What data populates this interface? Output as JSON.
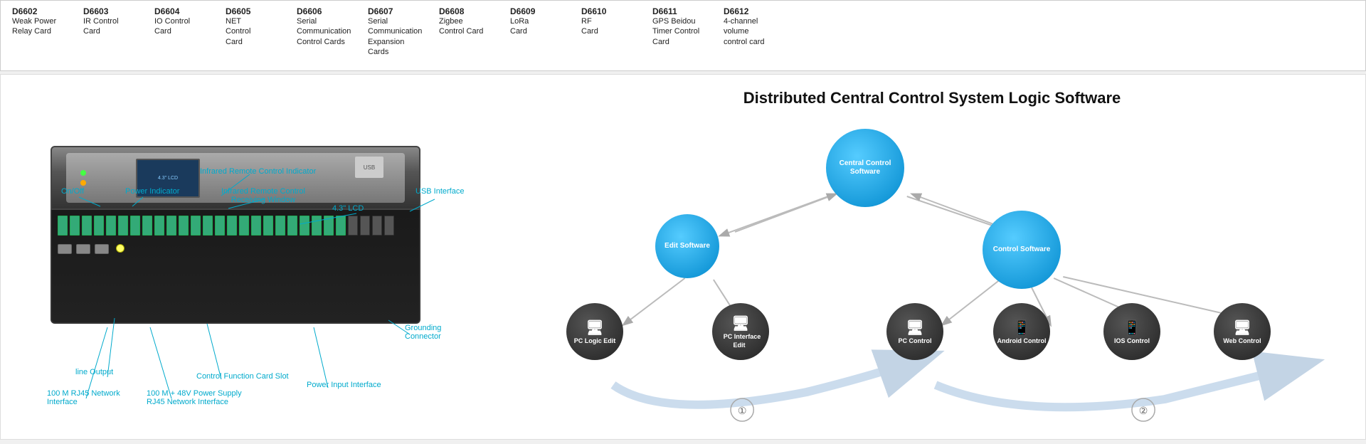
{
  "top_table": {
    "cards": [
      {
        "id": "D6602",
        "name": "Weak Power\nRelay Card"
      },
      {
        "id": "D6603",
        "name": "IR Control\nCard"
      },
      {
        "id": "D6604",
        "name": "IO Control\nCard"
      },
      {
        "id": "D6605",
        "name": "NET\nControl\nCard"
      },
      {
        "id": "D6606",
        "name": "Serial\nCommunication\nControl Cards"
      },
      {
        "id": "D6607",
        "name": "Serial\nCommunication\nExpansion\nCards"
      },
      {
        "id": "D6608",
        "name": "Zigbee\nControl Card"
      },
      {
        "id": "D6609",
        "name": "LoRa\nCard"
      },
      {
        "id": "D6610",
        "name": "RF\nCard"
      },
      {
        "id": "D6611",
        "name": "GPS Beidou\nTimer Control\nCard"
      },
      {
        "id": "D6612",
        "name": "4-channel\nvolume\ncontrol card"
      }
    ]
  },
  "section_labels": {
    "expansion_cards": "Expansion Cards",
    "control_cards": "Control Cards",
    "card": "Card"
  },
  "device_annotations": {
    "on_off": "On/Off",
    "power_indicator": "Power Indicator",
    "infrared_indicator": "Infrared Remote Control Indicator",
    "infrared_window": "Infrared Remote Control\nReceiving Window",
    "lcd": "4.3\" LCD",
    "usb": "USB Interface",
    "grounding": "Grounding\nConnector",
    "line_output": "line Output",
    "network_100m": "100 M RJ45 Network\nInterface",
    "power_supply": "100 M + 48V Power Supply\nRJ45 Network Interface",
    "control_slot": "Control Function Card Slot",
    "power_input": "Power Input Interface"
  },
  "diagram": {
    "title": "Distributed Central Control System Logic Software",
    "nodes": {
      "central": "Central\nControl\nSoftware",
      "edit": "Edit Software",
      "control": "Control\nSoftware",
      "pc_logic": "PC Logic\nEdit",
      "pc_interface": "PC Interface\nEdit",
      "pc_control": "PC Control",
      "android": "Android\nControl",
      "ios": "IOS Control",
      "web": "Web Control"
    },
    "numbers": [
      "①",
      "②"
    ]
  }
}
